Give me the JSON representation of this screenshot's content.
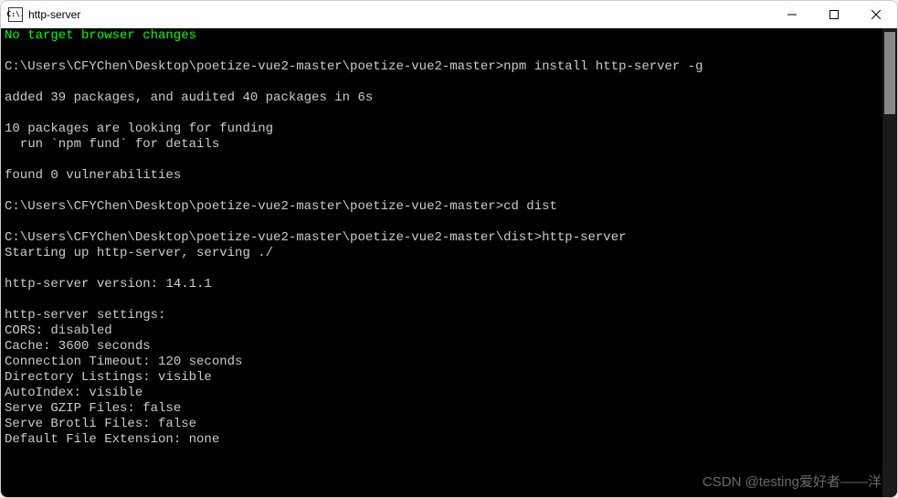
{
  "window": {
    "title": "http-server",
    "icon_text": "C:\\."
  },
  "terminal": {
    "status_line": "No target browser changes",
    "lines": [
      "",
      "C:\\Users\\CFYChen\\Desktop\\poetize-vue2-master\\poetize-vue2-master>npm install http-server -g",
      "",
      "added 39 packages, and audited 40 packages in 6s",
      "",
      "10 packages are looking for funding",
      "  run `npm fund` for details",
      "",
      "found 0 vulnerabilities",
      "",
      "C:\\Users\\CFYChen\\Desktop\\poetize-vue2-master\\poetize-vue2-master>cd dist",
      "",
      "C:\\Users\\CFYChen\\Desktop\\poetize-vue2-master\\poetize-vue2-master\\dist>http-server",
      "Starting up http-server, serving ./",
      "",
      "http-server version: 14.1.1",
      "",
      "http-server settings:",
      "CORS: disabled",
      "Cache: 3600 seconds",
      "Connection Timeout: 120 seconds",
      "Directory Listings: visible",
      "AutoIndex: visible",
      "Serve GZIP Files: false",
      "Serve Brotli Files: false",
      "Default File Extension: none"
    ]
  },
  "watermark": "CSDN @testing爱好者——洋"
}
